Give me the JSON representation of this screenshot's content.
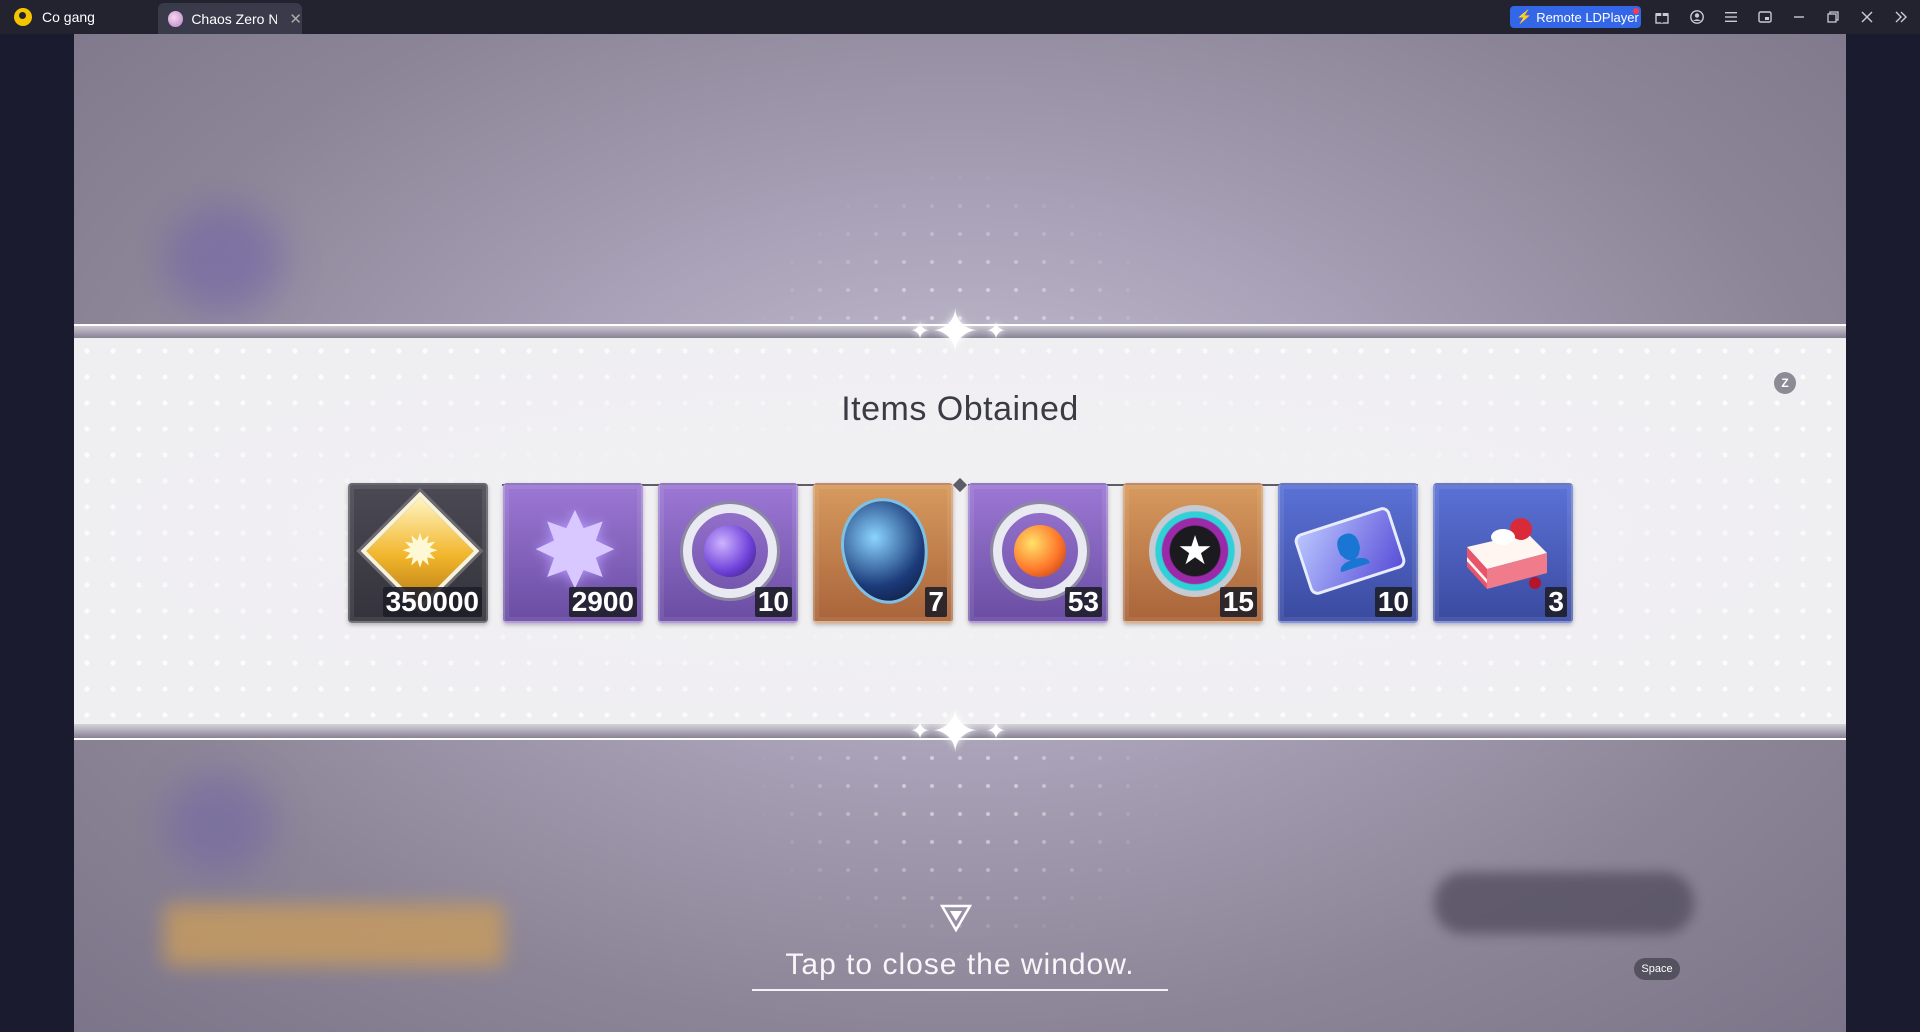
{
  "window": {
    "tabs": [
      {
        "label": "Co gang"
      },
      {
        "label": "Chaos Zero Ni..."
      }
    ],
    "remote_button": "Remote LDPlayer",
    "toolbar_icons": [
      "gift-icon",
      "account-icon",
      "menu-icon",
      "screen-icon",
      "minimize-icon",
      "restore-icon",
      "close-icon",
      "collapse-sidebar-icon"
    ]
  },
  "dialog": {
    "title": "Items Obtained",
    "hotkey_z": "Z",
    "items": [
      {
        "icon": "gold-crystal-icon",
        "qty": "350000",
        "rarity": "gray"
      },
      {
        "icon": "purple-star-shard-icon",
        "qty": "2900",
        "rarity": "purple"
      },
      {
        "icon": "purple-orb-ring-icon",
        "qty": "10",
        "rarity": "purple"
      },
      {
        "icon": "cosmic-egg-icon",
        "qty": "7",
        "rarity": "orange"
      },
      {
        "icon": "orange-orb-ring-icon",
        "qty": "53",
        "rarity": "purple"
      },
      {
        "icon": "star-gear-icon",
        "qty": "15",
        "rarity": "orange"
      },
      {
        "icon": "id-ticket-icon",
        "qty": "10",
        "rarity": "blue"
      },
      {
        "icon": "strawberry-cake-icon",
        "qty": "3",
        "rarity": "blue"
      }
    ],
    "close_prompt": "Tap to close the window.",
    "hotkey_space": "Space"
  },
  "colors": {
    "titlebar": "#22232f",
    "remote_button": "#3466e8",
    "panel": "#efeef1",
    "rarity_gray": "#4b4a54",
    "rarity_purple": "#8a66c4",
    "rarity_orange": "#c98048",
    "rarity_blue": "#4a5ec0"
  }
}
